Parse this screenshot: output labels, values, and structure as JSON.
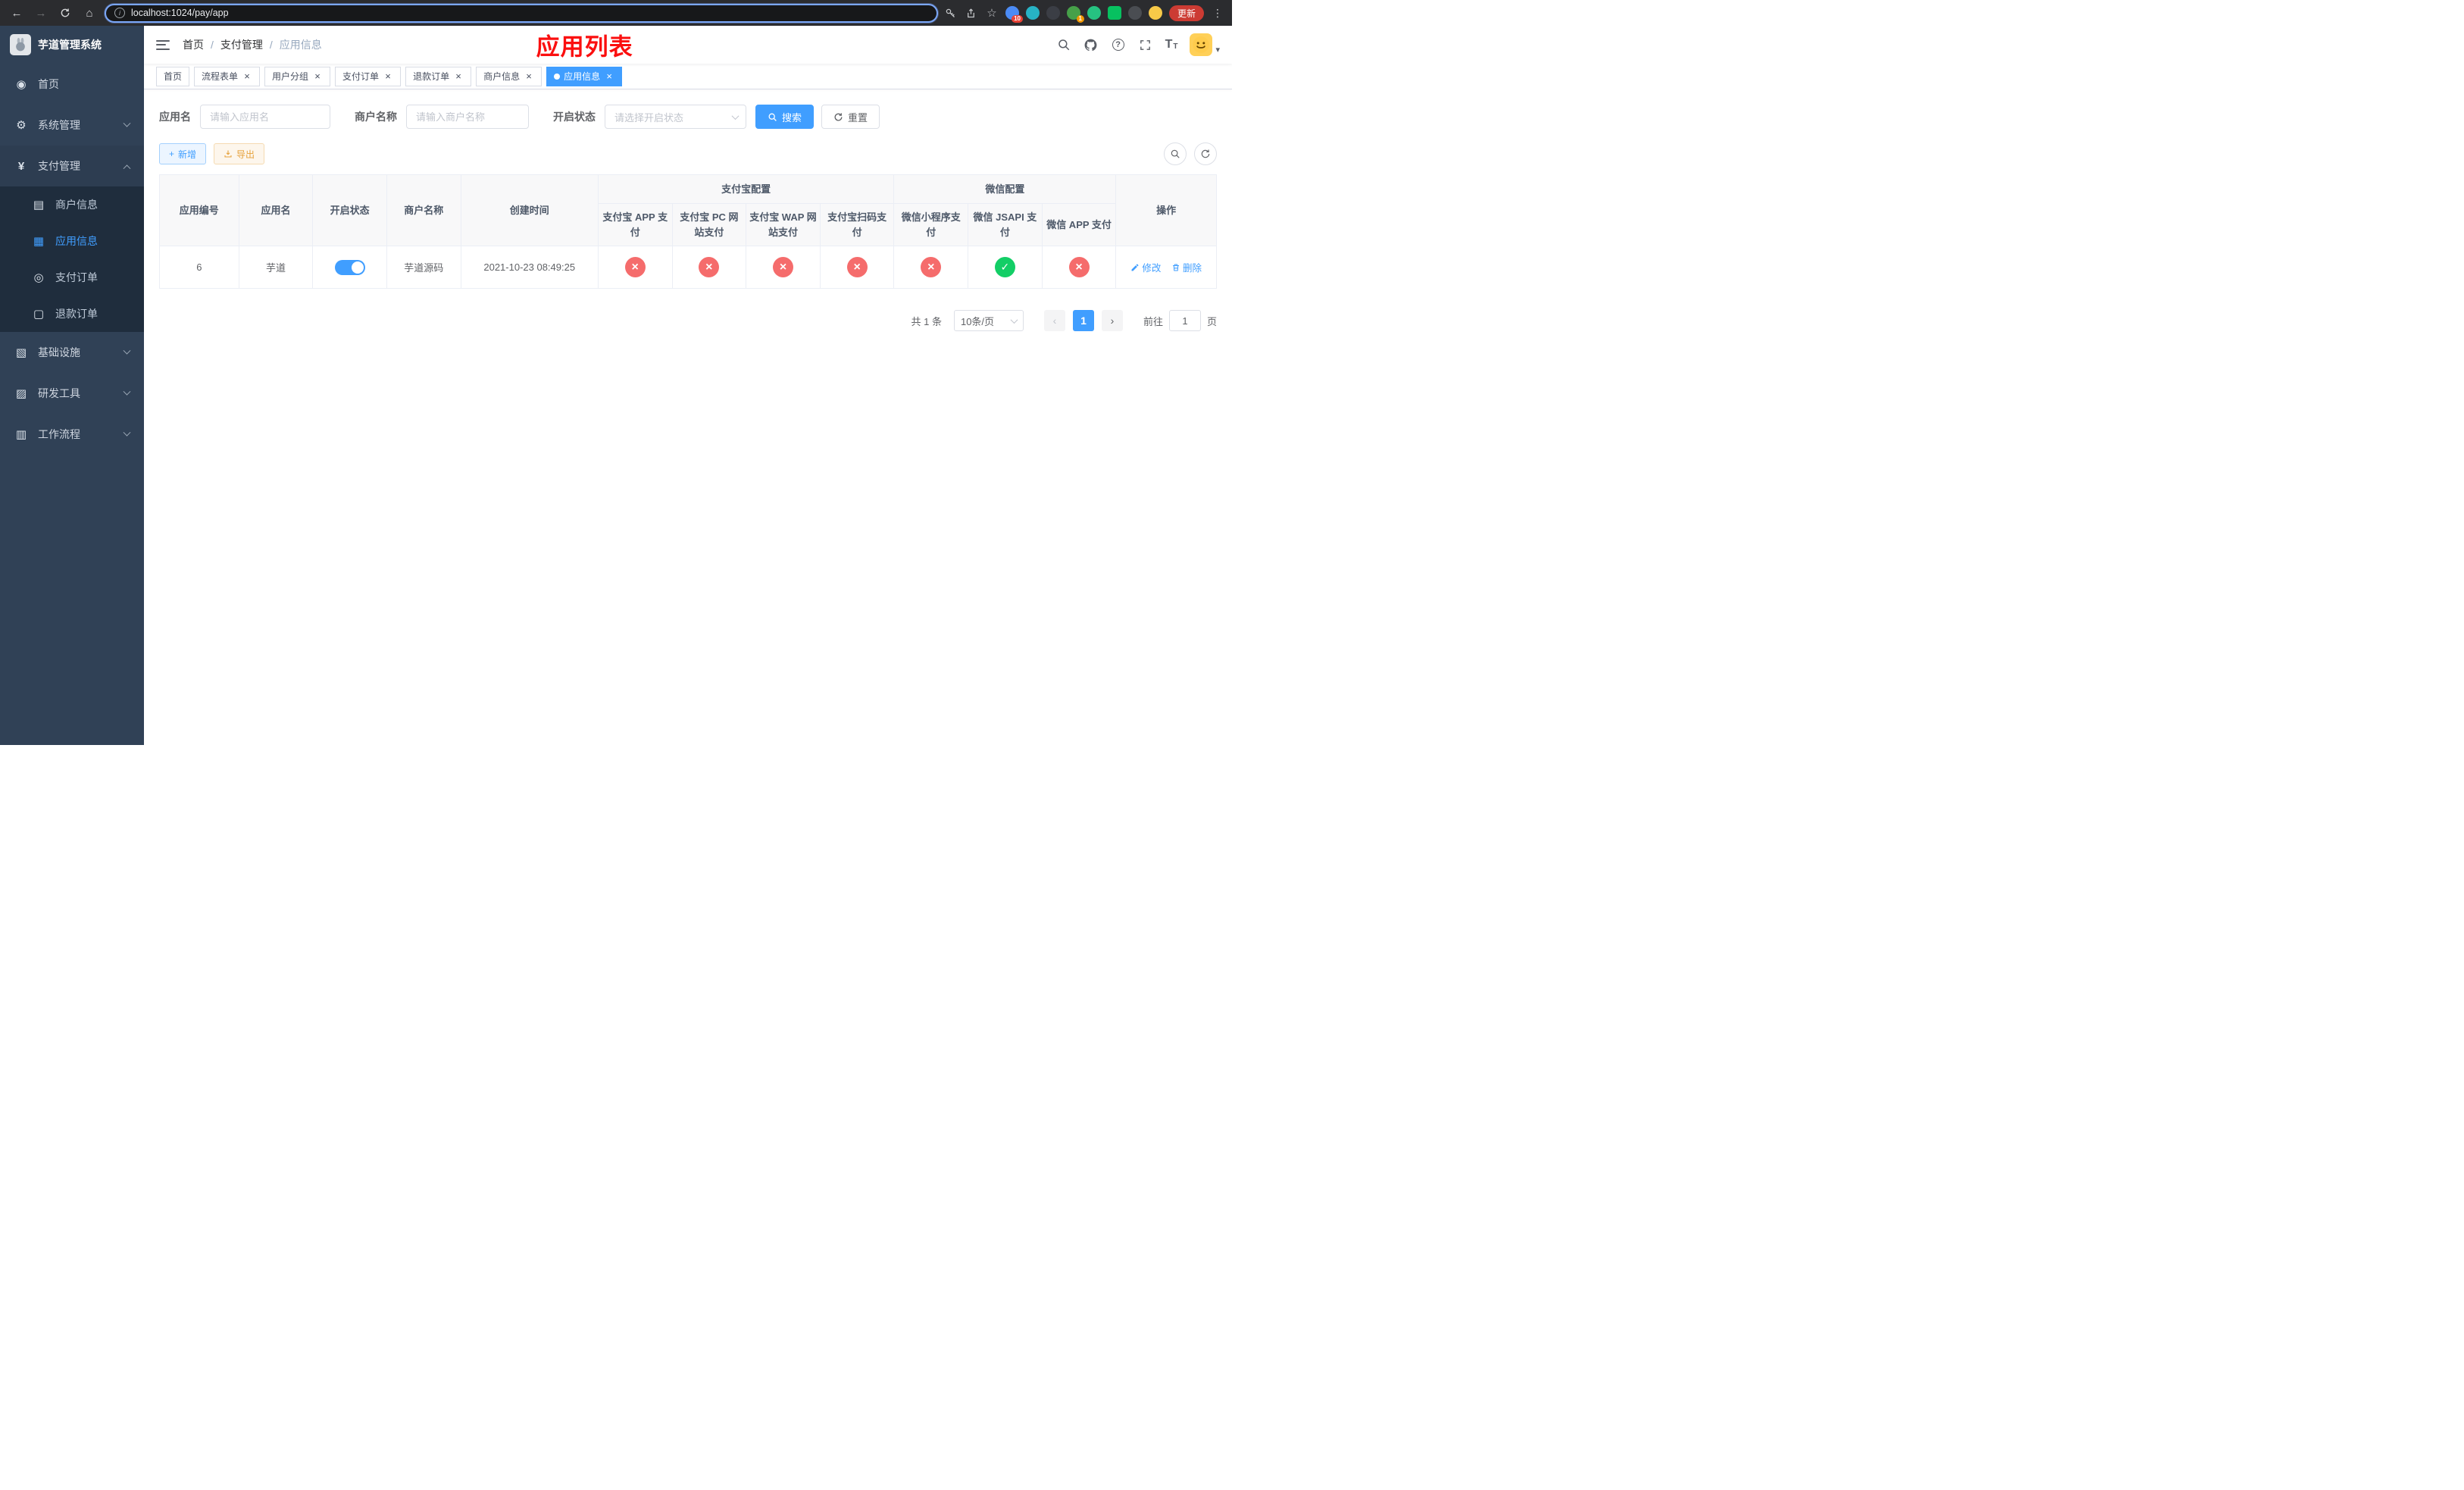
{
  "colors": {
    "accent": "#409eff",
    "success": "#13ce66",
    "danger": "#f56c6c",
    "warning": "#e6a23c",
    "title_red": "#fb0f0f",
    "sidebar_bg": "#304156",
    "submenu_bg": "#1f2d3d"
  },
  "browser": {
    "url": "localhost:1024/pay/app",
    "update_label": "更新",
    "ext_badge_blue": "10",
    "ext_badge_green": "1"
  },
  "icons": {
    "back": "←",
    "forward": "→",
    "home": "⌂",
    "info": "i",
    "star": "☆",
    "dots": "⋮",
    "close": "×",
    "plus": "+",
    "caret": "▾",
    "prev": "‹",
    "next": "›",
    "question": "?",
    "text_big": "T",
    "text_small": "T",
    "dashboard": "◉",
    "gear": "⚙",
    "yen": "¥",
    "merchant": "▤",
    "app": "▦",
    "order": "◎",
    "refund": "▢",
    "infra": "▧",
    "tools": "▨",
    "workflow": "▥"
  },
  "sidebar": {
    "title": "芋道管理系统",
    "home": "首页",
    "system": "系统管理",
    "payment": "支付管理",
    "merchant_info": "商户信息",
    "app_info": "应用信息",
    "pay_order": "支付订单",
    "refund_order": "退款订单",
    "infrastructure": "基础设施",
    "dev_tools": "研发工具",
    "workflow": "工作流程"
  },
  "header": {
    "breadcrumb_home": "首页",
    "breadcrumb_section": "支付管理",
    "breadcrumb_current": "应用信息",
    "breadcrumb_separator": "/",
    "overlay_title": "应用列表"
  },
  "tabs": [
    {
      "label": "首页",
      "closable": false,
      "active": false
    },
    {
      "label": "流程表单",
      "closable": true,
      "active": false
    },
    {
      "label": "用户分组",
      "closable": true,
      "active": false
    },
    {
      "label": "支付订单",
      "closable": true,
      "active": false
    },
    {
      "label": "退款订单",
      "closable": true,
      "active": false
    },
    {
      "label": "商户信息",
      "closable": true,
      "active": false
    },
    {
      "label": "应用信息",
      "closable": true,
      "active": true
    }
  ],
  "filters": {
    "app_name_label": "应用名",
    "app_name_placeholder": "请输入应用名",
    "merchant_label": "商户名称",
    "merchant_placeholder": "请输入商户名称",
    "status_label": "开启状态",
    "status_placeholder": "请选择开启状态",
    "search": "搜索",
    "reset": "重置"
  },
  "toolbar": {
    "add": "新增",
    "export": "导出"
  },
  "table": {
    "headers": {
      "app_id": "应用编号",
      "app_name": "应用名",
      "status": "开启状态",
      "merchant": "商户名称",
      "created": "创建时间",
      "alipay_group": "支付宝配置",
      "wechat_group": "微信配置",
      "alipay_app": "支付宝 APP 支付",
      "alipay_pc": "支付宝 PC 网站支付",
      "alipay_wap": "支付宝 WAP 网站支付",
      "alipay_qr": "支付宝扫码支付",
      "wechat_mini": "微信小程序支付",
      "wechat_jsapi": "微信 JSAPI 支付",
      "wechat_app": "微信 APP 支付",
      "actions": "操作"
    },
    "rows": [
      {
        "app_id": "6",
        "app_name": "芋道",
        "enabled": true,
        "merchant": "芋道源码",
        "created": "2021-10-23 08:49:25",
        "configs": {
          "alipay_app": false,
          "alipay_pc": false,
          "alipay_wap": false,
          "alipay_qr": false,
          "wechat_mini": false,
          "wechat_jsapi": true,
          "wechat_app": false
        },
        "edit": "修改",
        "delete": "删除"
      }
    ]
  },
  "pagination": {
    "total": "共 1 条",
    "page_size": "10条/页",
    "page": "1",
    "goto_label": "前往",
    "goto_value": "1",
    "goto_unit": "页"
  }
}
